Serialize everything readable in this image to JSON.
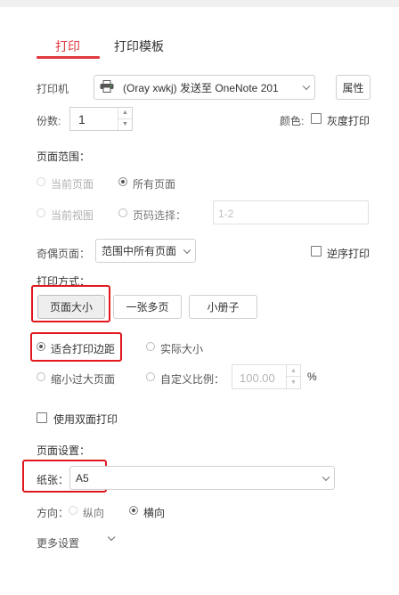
{
  "tabs": {
    "print": "打印",
    "template": "打印模板"
  },
  "printer": {
    "label": "打印机",
    "selected": "(Oray xwkj) 发送至 OneNote 201",
    "properties_button": "属性"
  },
  "copies": {
    "label": "份数:",
    "value": "1"
  },
  "color": {
    "label": "颜色:",
    "grayscale_label": "灰度打印",
    "grayscale_checked": false
  },
  "page_range": {
    "title": "页面范围：",
    "current_page": "当前页面",
    "all_pages": "所有页面",
    "current_view": "当前视图",
    "page_select": "页码选择：",
    "page_select_placeholder": "1-2"
  },
  "odd_even": {
    "label": "奇偶页面：",
    "selected": "范围中所有页面",
    "reverse_label": "逆序打印",
    "reverse_checked": false
  },
  "print_mode": {
    "title": "打印方式：",
    "page_size": "页面大小",
    "multi_page": "一张多页",
    "booklet": "小册子"
  },
  "scaling": {
    "fit_margins": "适合打印边距",
    "actual_size": "实际大小",
    "shrink_oversized": "缩小过大页面",
    "custom_scale": "自定义比例：",
    "custom_value": "100.00",
    "percent": "%"
  },
  "duplex": {
    "label": "使用双面打印",
    "checked": false
  },
  "page_setup": {
    "title": "页面设置：",
    "paper_label": "纸张：",
    "paper_value": "A5",
    "orientation_label": "方向：",
    "portrait": "纵向",
    "landscape": "横向"
  },
  "more_settings": "更多设置",
  "colors": {
    "accent": "#e0383e",
    "highlight": "#e0181e"
  }
}
